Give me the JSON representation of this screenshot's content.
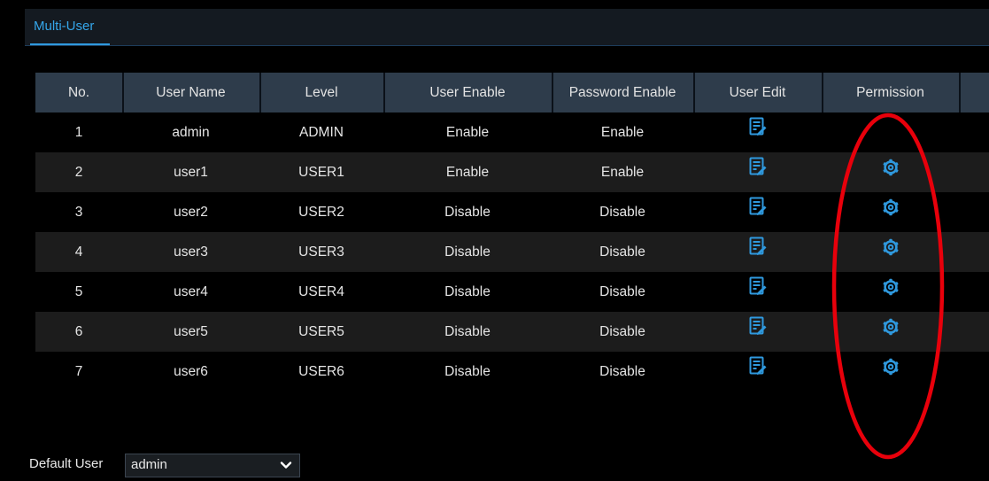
{
  "tabs": [
    {
      "label": "Multi-User",
      "active": true
    }
  ],
  "table": {
    "columns": [
      "No.",
      "User Name",
      "Level",
      "User Enable",
      "Password Enable",
      "User Edit",
      "Permission"
    ],
    "rows": [
      {
        "no": "1",
        "user_name": "admin",
        "level": "ADMIN",
        "user_enable": "Enable",
        "password_enable": "Enable",
        "has_permission": false
      },
      {
        "no": "2",
        "user_name": "user1",
        "level": "USER1",
        "user_enable": "Enable",
        "password_enable": "Enable",
        "has_permission": true
      },
      {
        "no": "3",
        "user_name": "user2",
        "level": "USER2",
        "user_enable": "Disable",
        "password_enable": "Disable",
        "has_permission": true
      },
      {
        "no": "4",
        "user_name": "user3",
        "level": "USER3",
        "user_enable": "Disable",
        "password_enable": "Disable",
        "has_permission": true
      },
      {
        "no": "5",
        "user_name": "user4",
        "level": "USER4",
        "user_enable": "Disable",
        "password_enable": "Disable",
        "has_permission": true
      },
      {
        "no": "6",
        "user_name": "user5",
        "level": "USER5",
        "user_enable": "Disable",
        "password_enable": "Disable",
        "has_permission": true
      },
      {
        "no": "7",
        "user_name": "user6",
        "level": "USER6",
        "user_enable": "Disable",
        "password_enable": "Disable",
        "has_permission": true
      }
    ]
  },
  "icons": {
    "edit": "edit-icon",
    "permission": "gear-icon",
    "dropdown": "chevron-down-icon"
  },
  "footer": {
    "default_user_label": "Default User",
    "default_user_value": "admin"
  },
  "colors": {
    "accent": "#2f99de",
    "header_bg": "#2e3c4b",
    "annotation": "#e8000b"
  }
}
